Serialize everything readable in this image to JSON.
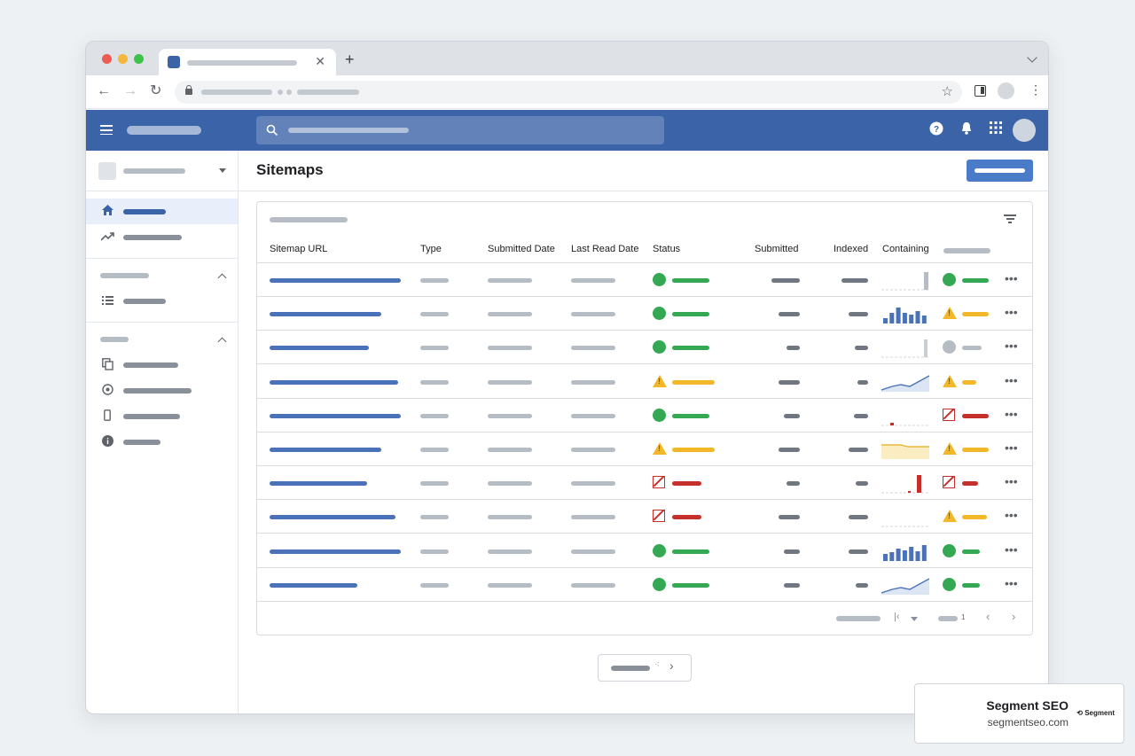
{
  "page": {
    "title": "Sitemaps"
  },
  "table": {
    "columns": [
      "Sitemap URL",
      "Type",
      "Submitted Date",
      "Last Read Date",
      "Status",
      "Submitted",
      "Indexed",
      "Containing"
    ],
    "rows": [
      {
        "status": "success",
        "spark": "bar-last",
        "detail": "success"
      },
      {
        "status": "success",
        "spark": "bars",
        "detail": "warning"
      },
      {
        "status": "success",
        "spark": "bar-last-light",
        "detail": "neutral"
      },
      {
        "status": "warning",
        "spark": "area-up",
        "detail": "warning"
      },
      {
        "status": "success",
        "spark": "dashes-red",
        "detail": "error"
      },
      {
        "status": "warning",
        "spark": "area-yellow",
        "detail": "warning"
      },
      {
        "status": "error",
        "spark": "red-spike",
        "detail": "error"
      },
      {
        "status": "error",
        "spark": "dashes",
        "detail": "warning"
      },
      {
        "status": "success",
        "spark": "bars-blue",
        "detail": "success"
      },
      {
        "status": "success",
        "spark": "area-up",
        "detail": "success"
      }
    ]
  },
  "pagination": {
    "page": "1"
  },
  "watermark": {
    "title": "Segment SEO",
    "url": "segmentseo.com",
    "logo_text": "Segment"
  },
  "colors": {
    "brand": "#3b63a8",
    "success": "#34a853",
    "warning": "#f2b82a",
    "error": "#c5302b"
  },
  "icons": [
    "menu-icon",
    "search-icon",
    "help-icon",
    "bell-icon",
    "apps-icon",
    "home-icon",
    "trending-icon",
    "list-icon",
    "copy-icon",
    "settings-icon",
    "phone-icon",
    "info-icon",
    "filter-icon",
    "more-icon"
  ]
}
